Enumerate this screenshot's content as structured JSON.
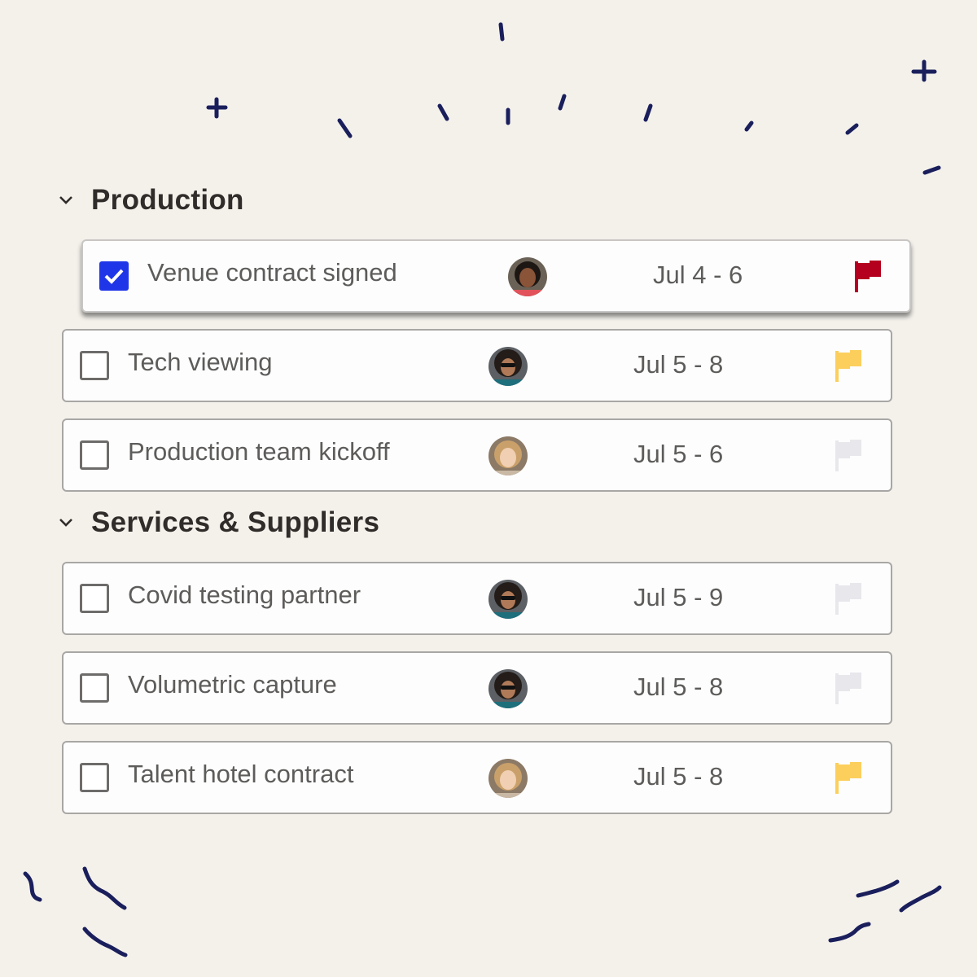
{
  "sections": [
    {
      "title": "Production",
      "tasks": [
        {
          "name": "Venue contract signed",
          "checked": true,
          "assignee": "avatar-woman-dark-hair",
          "date": "Jul 4 - 6",
          "flag": "red"
        },
        {
          "name": "Tech viewing",
          "checked": false,
          "assignee": "avatar-man-sunglasses",
          "date": "Jul 5 - 8",
          "flag": "yellow"
        },
        {
          "name": "Production team kickoff",
          "checked": false,
          "assignee": "avatar-woman-blonde",
          "date": "Jul 5 - 6",
          "flag": "none"
        }
      ]
    },
    {
      "title": "Services & Suppliers",
      "tasks": [
        {
          "name": "Covid testing partner",
          "checked": false,
          "assignee": "avatar-man-sunglasses",
          "date": "Jul 5 - 9",
          "flag": "none"
        },
        {
          "name": "Volumetric capture",
          "checked": false,
          "assignee": "avatar-man-sunglasses",
          "date": "Jul 5 - 8",
          "flag": "none"
        },
        {
          "name": "Talent hotel contract",
          "checked": false,
          "assignee": "avatar-woman-blonde",
          "date": "Jul 5 - 8",
          "flag": "yellow"
        }
      ]
    }
  ],
  "colors": {
    "background": "#f4f1eb",
    "checkbox_checked": "#1f36e8",
    "flag_red": "#b4001e",
    "flag_yellow": "#fccf5c",
    "flag_none": "#e8e7ec",
    "doodle": "#1a1f5c"
  }
}
